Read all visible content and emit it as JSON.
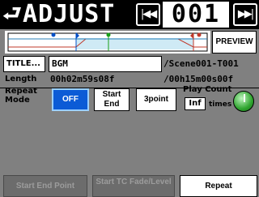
{
  "header": {
    "title": "ADJUST",
    "prev_label": "|◀◀",
    "scene_number": "001",
    "next_label": "▶▶|"
  },
  "timeline": {
    "preview_label": "PREVIEW"
  },
  "title_row": {
    "button_label": "TITLE...",
    "title_value": "BGM",
    "scene_path": "/Scene001-T001"
  },
  "length_row": {
    "label": "Length",
    "value": "00h02m59s08f",
    "total": "/00h15m00s00f"
  },
  "repeat": {
    "label_line1": "Repeat",
    "label_line2": "Mode",
    "options": [
      {
        "label": "OFF",
        "selected": true
      },
      {
        "label": "Start End",
        "selected": false
      },
      {
        "label": "3point",
        "selected": false
      }
    ],
    "play_count_label": "Play Count",
    "play_count_value": "Inf",
    "play_count_unit": "times"
  },
  "tabs": [
    {
      "label": "Start End Point",
      "active": false
    },
    {
      "label": "Start TC Fade/Level",
      "active": false
    },
    {
      "label": "Repeat",
      "active": true
    }
  ],
  "colors": {
    "accent_blue": "#0b5bd6",
    "knob_green": "#2fa52f",
    "background": "#808080"
  }
}
